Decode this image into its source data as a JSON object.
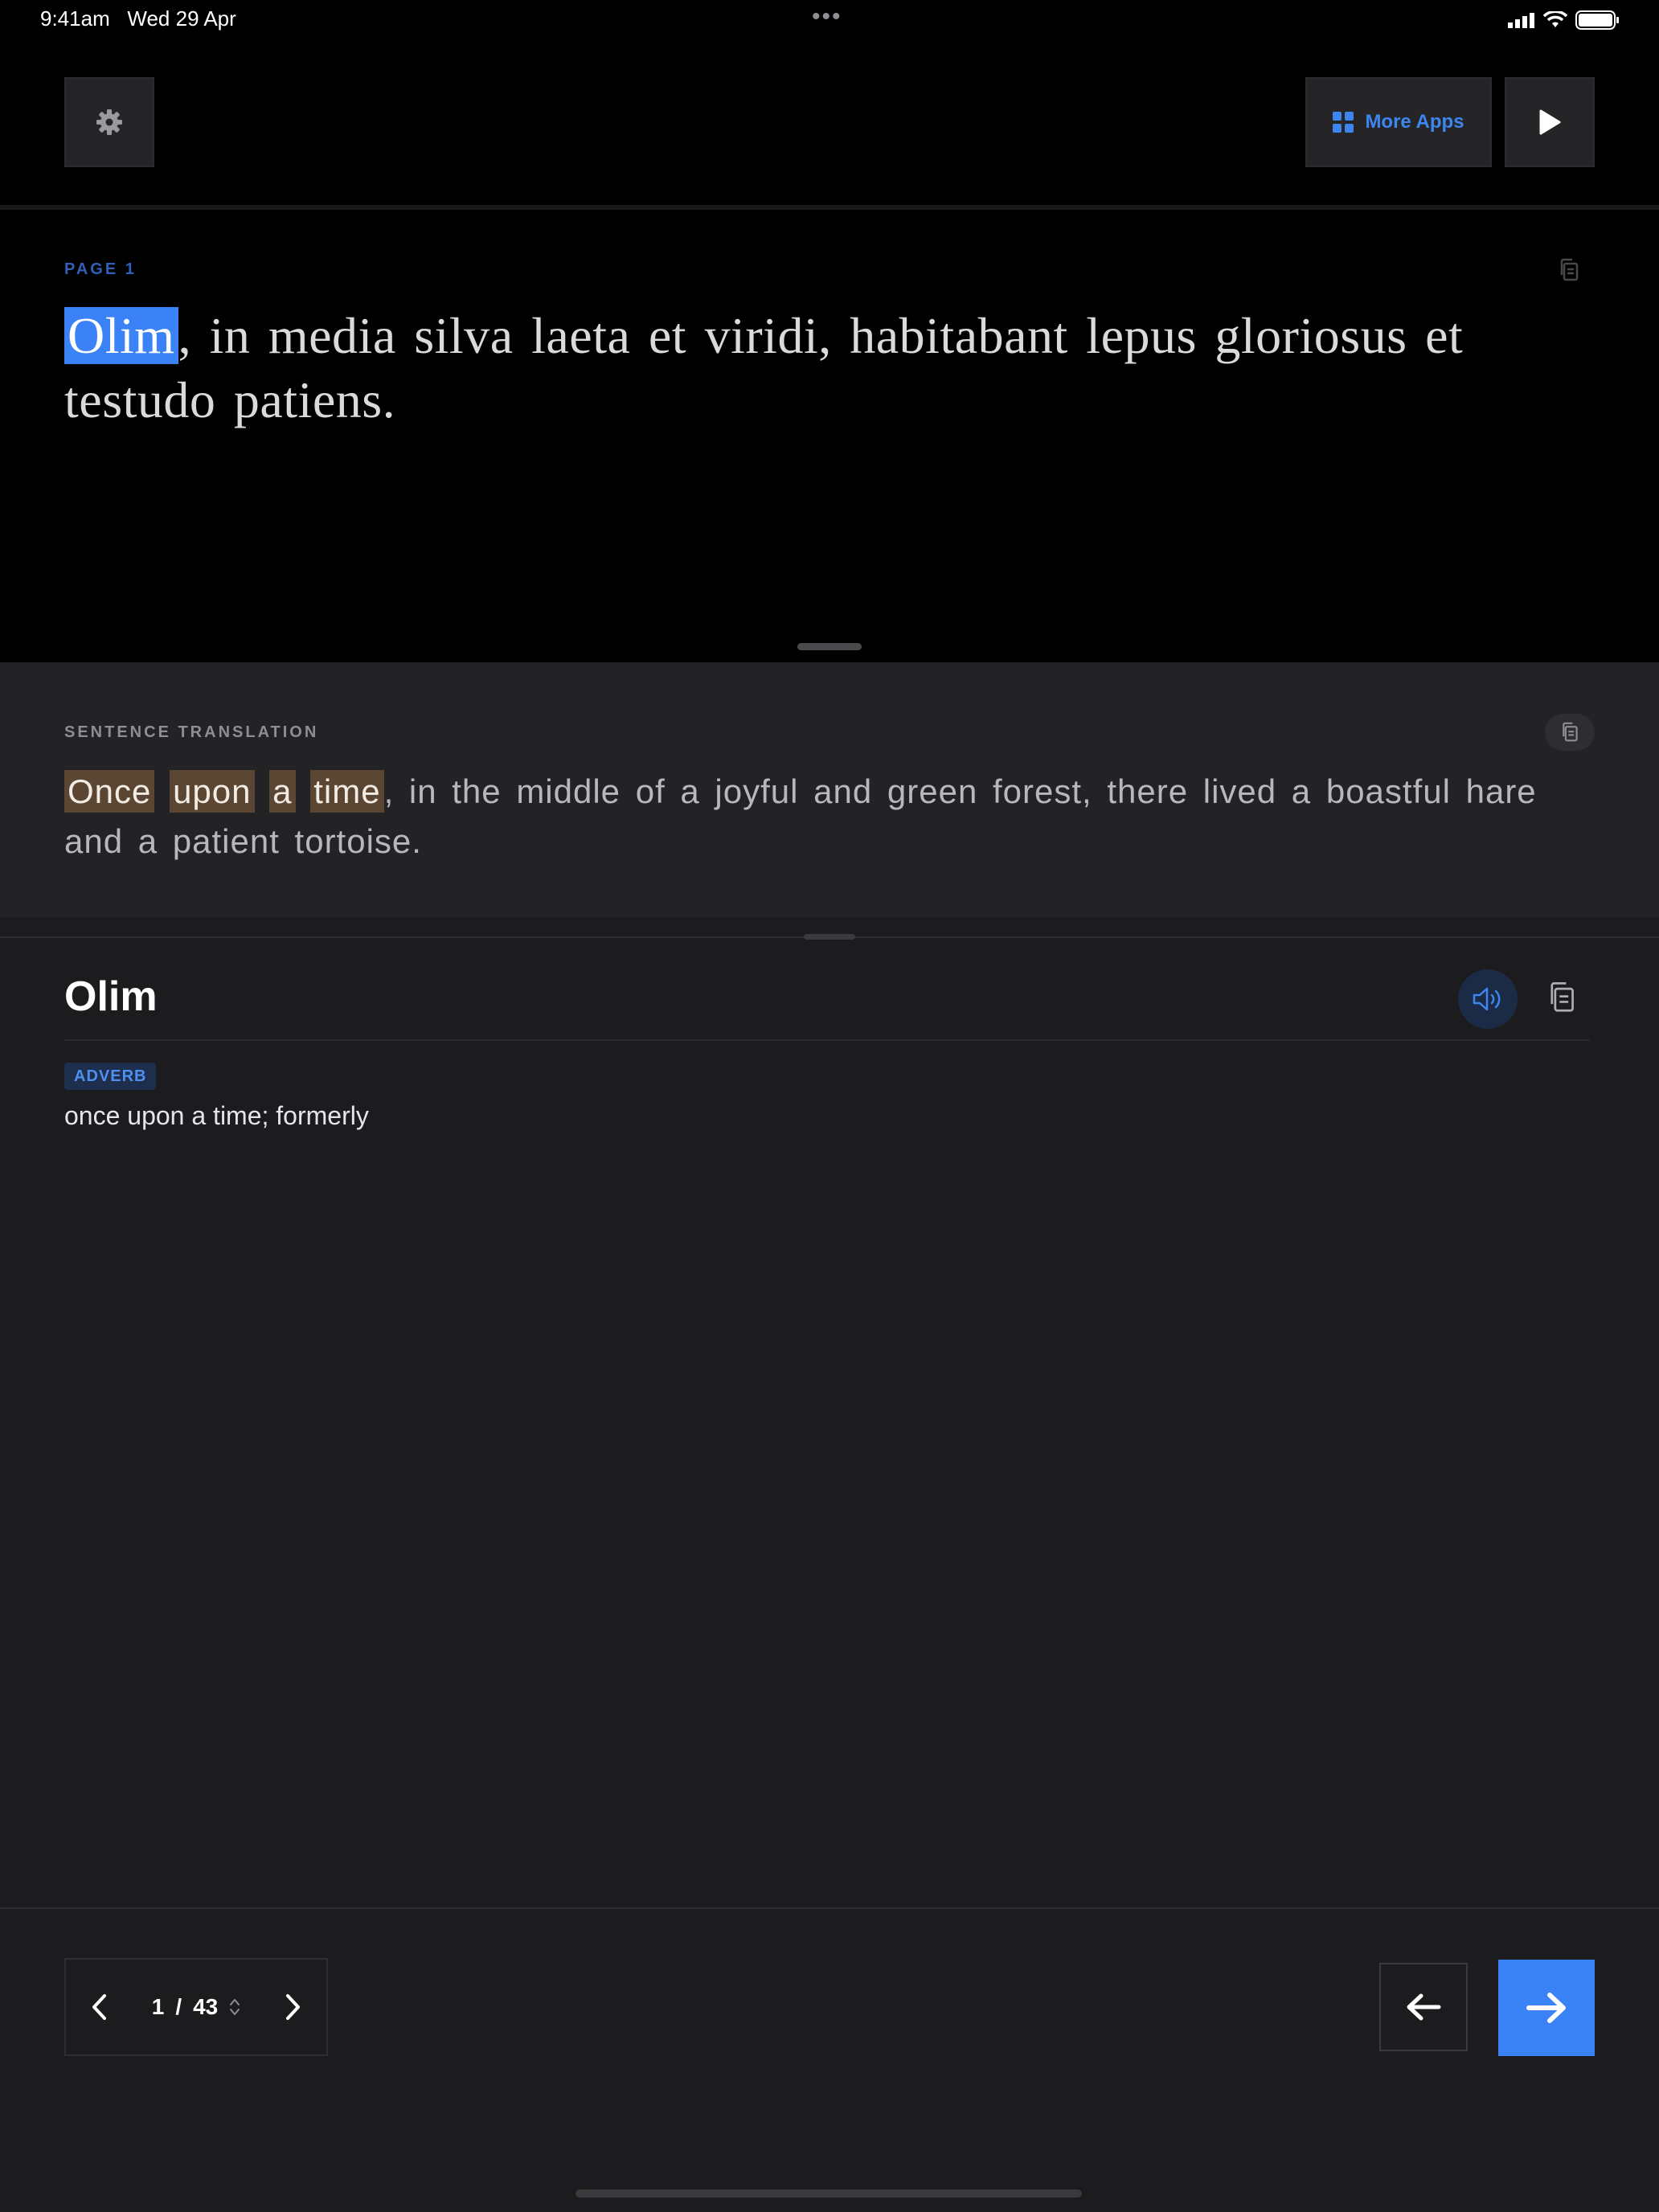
{
  "status_bar": {
    "time": "9:41am",
    "date": "Wed 29 Apr",
    "dots": "•••"
  },
  "toolbar": {
    "more_apps_label": "More Apps"
  },
  "reader": {
    "page_label": "PAGE 1",
    "highlighted_word": "Olim",
    "sentence_rest": ", in media silva laeta et viridi, habitabant lepus gloriosus et testudo patiens."
  },
  "translation": {
    "label": "SENTENCE TRANSLATION",
    "phrase_words": [
      "Once",
      "upon",
      "a",
      "time"
    ],
    "rest": ", in the middle of a joyful and green forest, there lived a boastful hare and a patient tortoise."
  },
  "word_detail": {
    "word": "Olim",
    "part_of_speech": "ADVERB",
    "definition": "once upon a time; formerly"
  },
  "pager": {
    "current": "1",
    "separator": "/",
    "total": "43"
  },
  "colors": {
    "accent": "#3b82f6",
    "highlight_phrase": "#5a4632",
    "background": "#1c1c1e"
  },
  "icons": [
    "gear-icon",
    "grid-icon",
    "play-icon",
    "copy-icon",
    "speaker-icon",
    "chevron-left-icon",
    "chevron-right-icon",
    "arrow-left-icon",
    "arrow-right-icon"
  ]
}
